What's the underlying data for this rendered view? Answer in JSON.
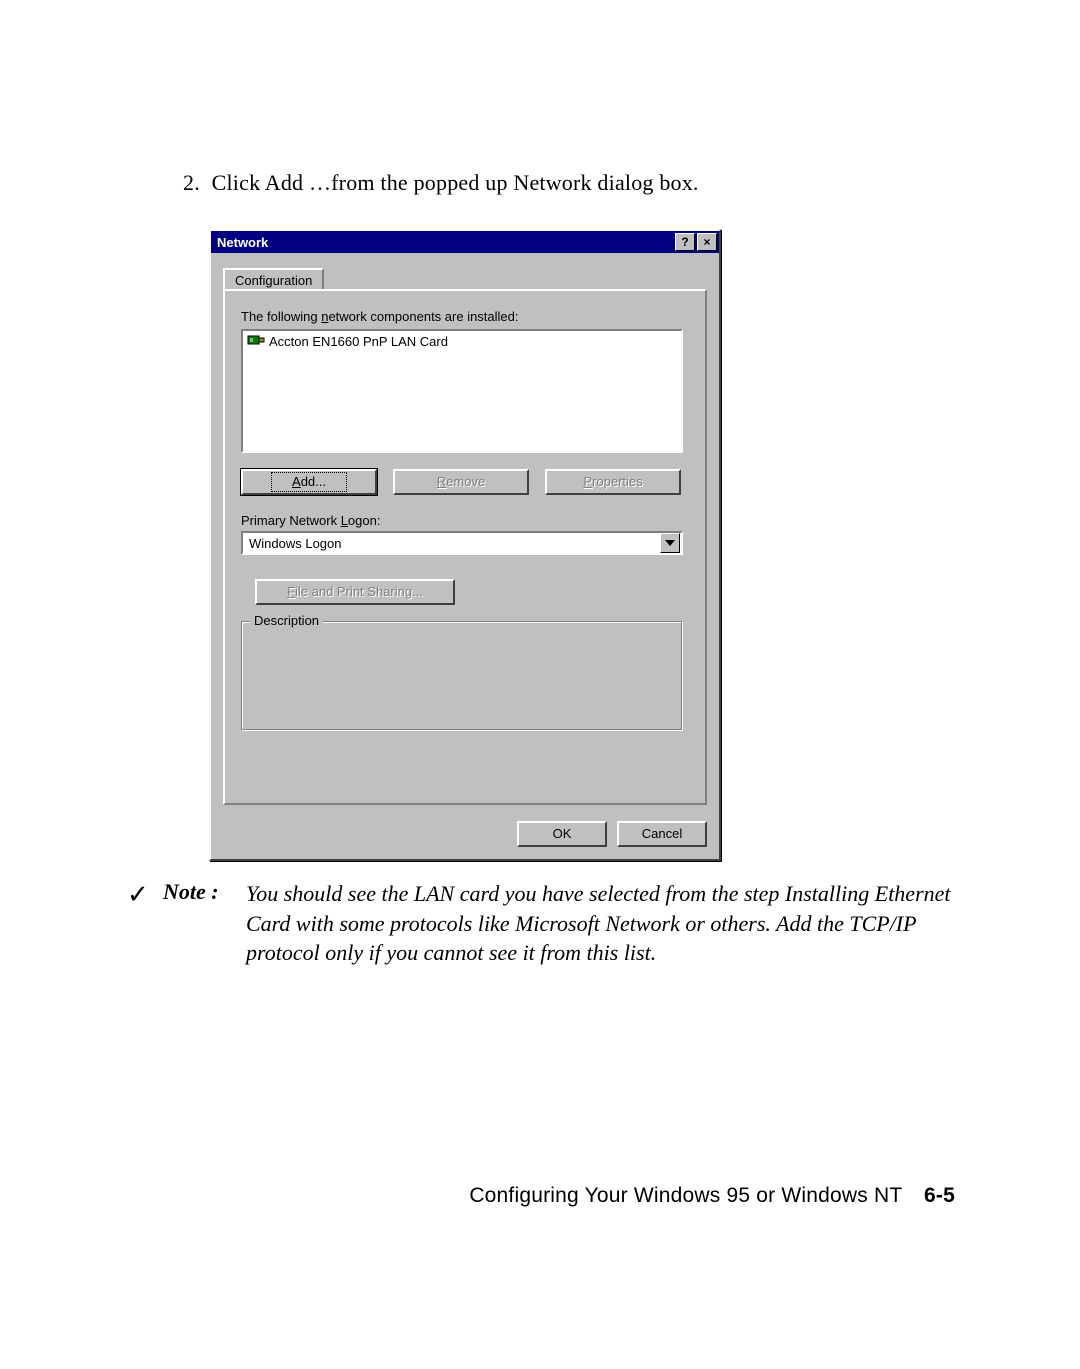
{
  "instruction": {
    "number": "2.",
    "text": "Click Add …from the popped up Network dialog box."
  },
  "dialog": {
    "title": "Network",
    "help_glyph": "?",
    "close_glyph": "×",
    "tab": "Configuration",
    "installed_label_pre": "The following ",
    "installed_label_underline_char": "n",
    "installed_label_post": "etwork components are installed:",
    "listbox": {
      "items": [
        "Accton EN1660 PnP LAN Card"
      ]
    },
    "buttons": {
      "add_u": "A",
      "add_rest": "dd...",
      "remove_u": "R",
      "remove_rest": "emove",
      "properties_u": "P",
      "properties_rest": "roperties"
    },
    "primary_logon_pre": "Primary Network ",
    "primary_logon_underline_char": "L",
    "primary_logon_post": "ogon:",
    "combo_value": "Windows Logon",
    "fps_u": "F",
    "fps_rest": "ile and Print Sharing...",
    "group_legend": "Description",
    "ok": "OK",
    "cancel": "Cancel"
  },
  "note": {
    "check": "✓",
    "label": "Note :",
    "text": "You should see the LAN card you have selected from the step Installing Ethernet Card with some protocols like Microsoft Network or others. Add the TCP/IP protocol only if you cannot see it from this list."
  },
  "footer": {
    "text": "Configuring Your Windows 95 or Windows NT",
    "page": "6-5"
  }
}
